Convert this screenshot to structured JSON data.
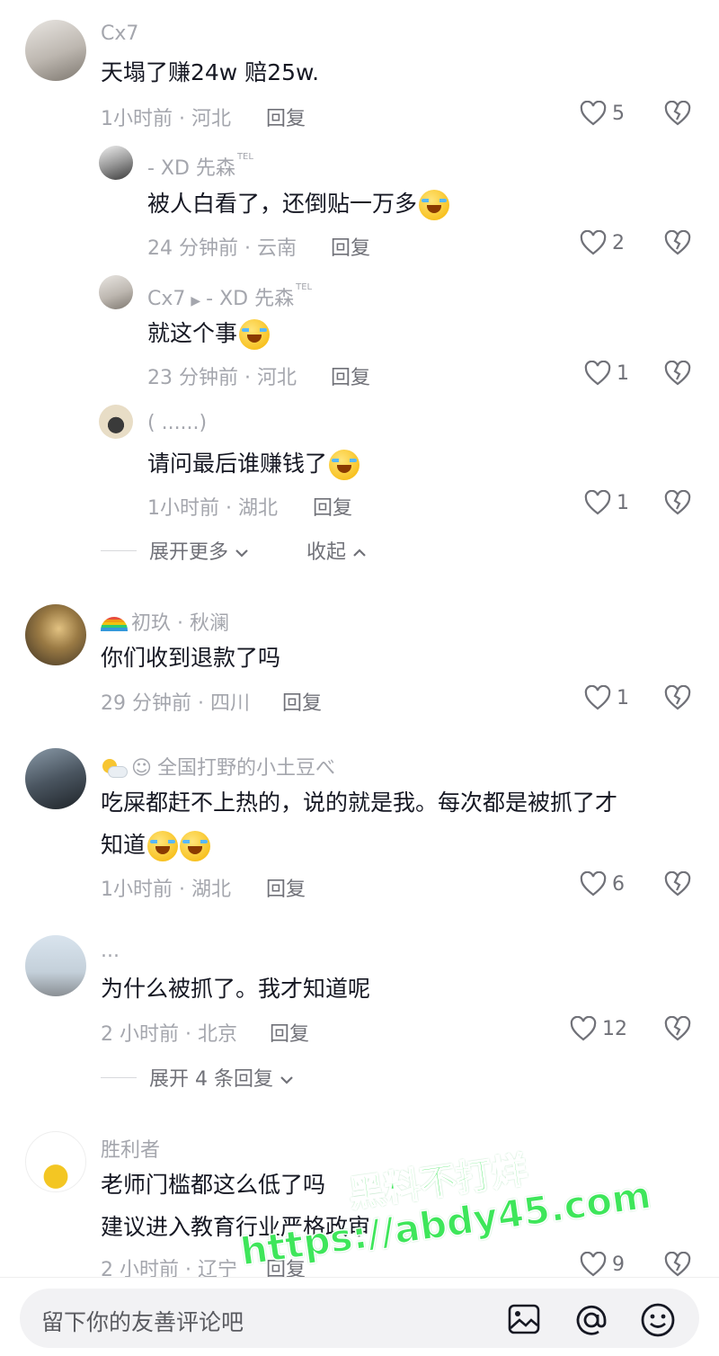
{
  "comments": [
    {
      "user": "Cx7",
      "text": "天塌了赚24w 赔25w.",
      "meta": "1小时前 · 河北",
      "reply": "回复",
      "likes": "5",
      "replies": [
        {
          "user": "- XD 先森",
          "user_sup": "TEL",
          "text": "被人白看了，还倒贴一万多",
          "meta": "24 分钟前 · 云南",
          "reply": "回复",
          "likes": "2"
        },
        {
          "user": "Cx7",
          "reply_to": "- XD 先森",
          "reply_to_sup": "TEL",
          "text": "就这个事",
          "meta": "23 分钟前 · 河北",
          "reply": "回复",
          "likes": "1"
        },
        {
          "user": "( ......)",
          "text": "请问最后谁赚钱了",
          "meta": "1小时前 · 湖北",
          "reply": "回复",
          "likes": "1"
        }
      ],
      "expand_more": "展开更多",
      "collapse": "收起"
    },
    {
      "user": "初玖 · 秋澜",
      "text": "你们收到退款了吗",
      "meta": "29 分钟前 · 四川",
      "reply": "回复",
      "likes": "1"
    },
    {
      "user": "全国打野的小土豆べ",
      "text_line1": "吃屎都赶不上热的，说的就是我。每次都是被抓了才",
      "text_line2": "知道",
      "meta": "1小时前 · 湖北",
      "reply": "回复",
      "likes": "6"
    },
    {
      "user": "...",
      "text": "为什么被抓了。我才知道呢",
      "meta": "2 小时前 · 北京",
      "reply": "回复",
      "likes": "12",
      "expand_replies": "展开 4 条回复"
    },
    {
      "user": "胜利者",
      "text_line1": "老师门槛都这么低了吗",
      "text_line2": "建议进入教育行业严格政审",
      "meta": "2 小时前 · 辽宁",
      "reply": "回复",
      "likes": "9"
    }
  ],
  "input": {
    "placeholder": "留下你的友善评论吧"
  },
  "icons": [
    "heart-icon",
    "dislike-heart-icon",
    "chevron-down-icon",
    "chevron-up-icon",
    "image-icon",
    "at-icon",
    "emoji-icon",
    "sun-cloud-icon",
    "rainbow-icon",
    "smiley-badge-icon"
  ],
  "watermark": {
    "line1": "黑料不打烊",
    "line2": "https://abdy45.com"
  },
  "colors": {
    "text": "#161823",
    "meta": "#a4a6ad",
    "reply": "#707178",
    "watermark": "#3ee65a"
  }
}
